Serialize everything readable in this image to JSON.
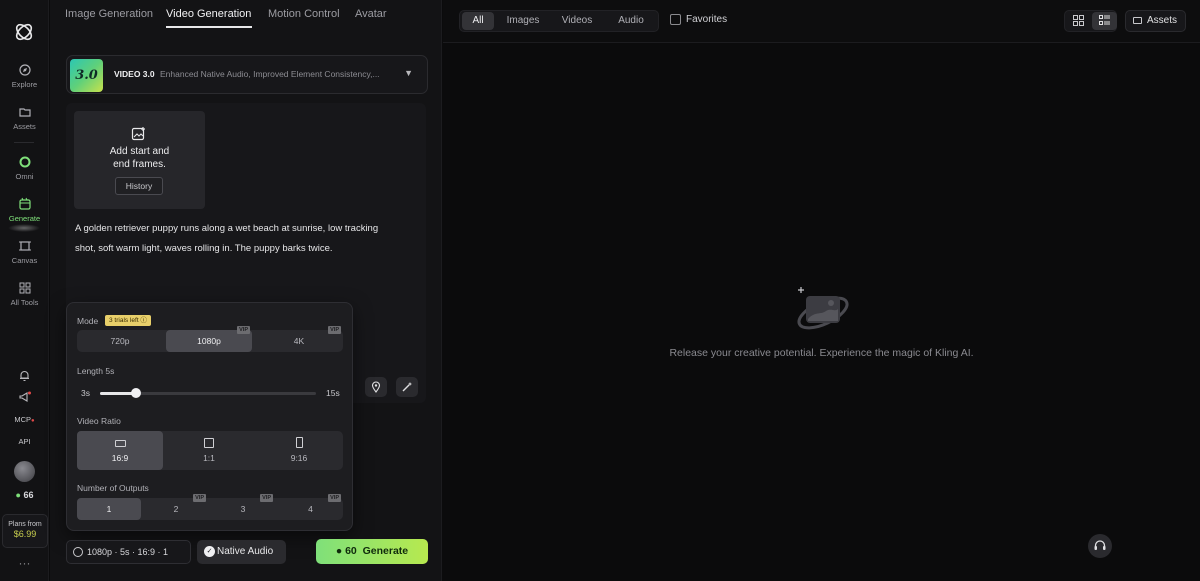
{
  "rail": {
    "items": [
      {
        "label": "Explore",
        "icon": "compass-icon"
      },
      {
        "label": "Assets",
        "icon": "folder-icon"
      },
      {
        "label": "Omni",
        "icon": "omni-ring-icon"
      },
      {
        "label": "Generate",
        "icon": "generate-icon",
        "active": true
      },
      {
        "label": "Canvas",
        "icon": "canvas-icon"
      },
      {
        "label": "All Tools",
        "icon": "grid-icon"
      }
    ],
    "mcp_label": "MCP",
    "api_label": "API",
    "credits": "66",
    "plans_label": "Plans from",
    "plans_price": "$6.99",
    "more": "···"
  },
  "tabs": [
    {
      "label": "Image Generation"
    },
    {
      "label": "Video Generation",
      "active": true
    },
    {
      "label": "Motion Control"
    },
    {
      "label": "Avatar"
    }
  ],
  "model": {
    "badge": "3.0",
    "name": "VIDEO 3.0",
    "description": "Enhanced Native Audio, Improved Element Consistency,..."
  },
  "frames": {
    "line1": "Add start and",
    "line2": "end frames.",
    "history_label": "History"
  },
  "prompt": {
    "line1": "A golden retriever puppy runs along a wet beach at sunrise, low tracking",
    "line2": "shot, soft warm light, waves rolling in. The puppy barks twice."
  },
  "settings": {
    "mode_label": "Mode",
    "trial_badge": "3 trials left ⓘ",
    "resolutions": [
      {
        "label": "720p",
        "vip": false
      },
      {
        "label": "1080p",
        "vip": true,
        "selected": true
      },
      {
        "label": "4K",
        "vip": true
      }
    ],
    "vip_label": "VIP",
    "length_label": "Length 5s",
    "length_min": "3s",
    "length_max": "15s",
    "length_value_seconds": 5,
    "length_range_seconds": [
      3,
      15
    ],
    "ratio_label": "Video Ratio",
    "ratios": [
      {
        "label": "16:9",
        "selected": true
      },
      {
        "label": "1:1"
      },
      {
        "label": "9:16"
      }
    ],
    "outputs_label": "Number of Outputs",
    "outputs": [
      {
        "label": "1",
        "selected": true,
        "vip": false
      },
      {
        "label": "2",
        "vip": true
      },
      {
        "label": "3",
        "vip": true
      },
      {
        "label": "4",
        "vip": true
      }
    ]
  },
  "bottom": {
    "settings_summary": "1080p · 5s · 16:9 · 1",
    "audio_label": "Native Audio",
    "generate_cost": "60",
    "generate_label": "Generate"
  },
  "topbar": {
    "filters": [
      {
        "label": "All",
        "selected": true
      },
      {
        "label": "Images"
      },
      {
        "label": "Videos"
      },
      {
        "label": "Audio"
      }
    ],
    "favorites_label": "Favorites",
    "assets_label": "Assets"
  },
  "empty_state": {
    "text": "Release your creative potential. Experience the magic of Kling AI."
  },
  "colors": {
    "accent_green": "#7fe07a",
    "accent_lime": "#b7e94f",
    "trial_badge": "#e8cf6a"
  }
}
